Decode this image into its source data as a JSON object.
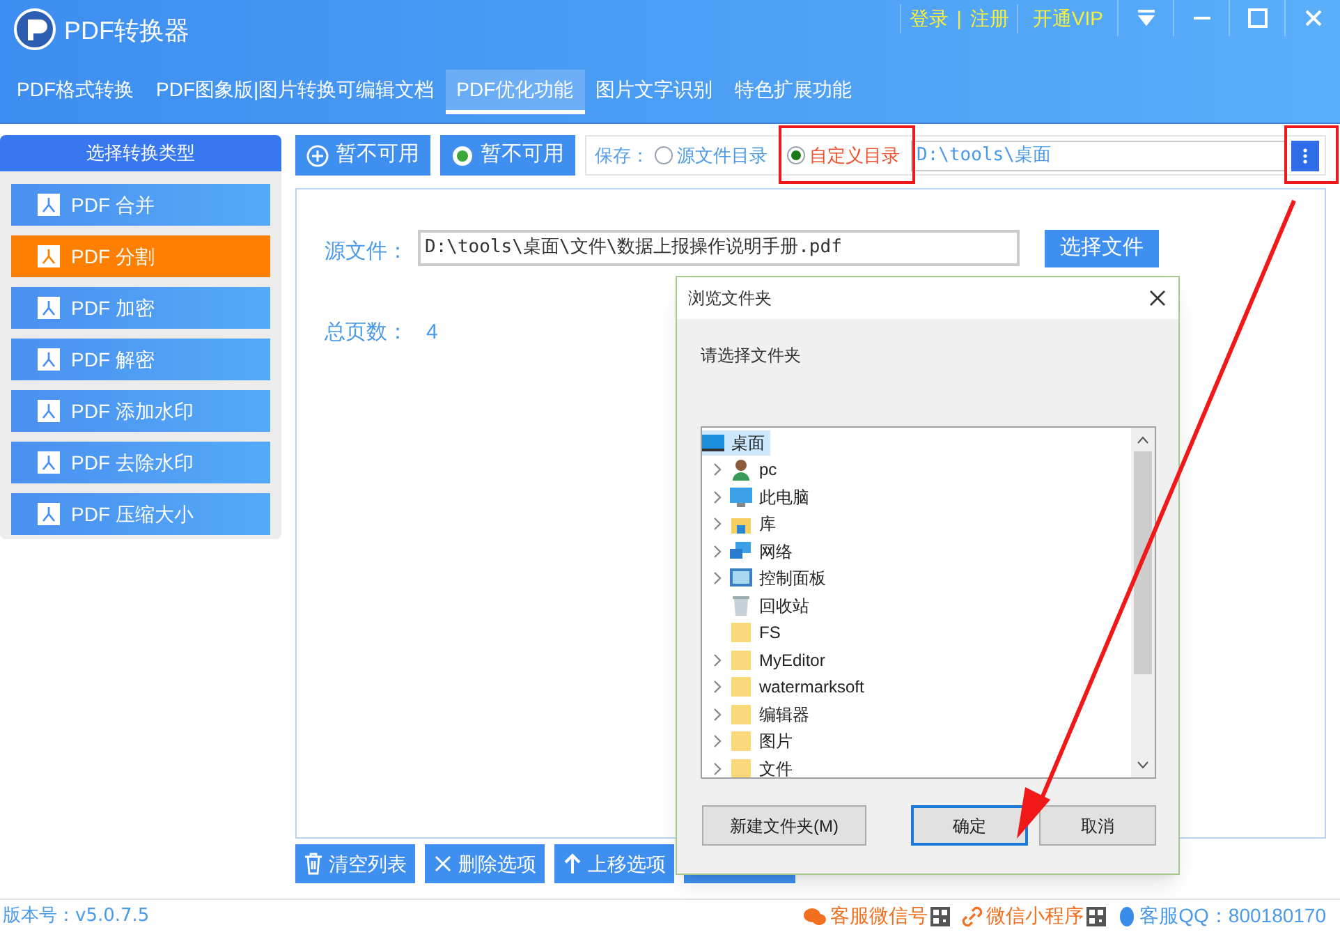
{
  "window": {
    "title": "PDF转换器",
    "links": [
      "登录",
      "|",
      "注册",
      "开通VIP"
    ]
  },
  "tabs": [
    {
      "label": "PDF格式转换",
      "selected": false
    },
    {
      "label": "PDF图象版|图片转换可编辑文档",
      "selected": false
    },
    {
      "label": "PDF优化功能",
      "selected": true
    },
    {
      "label": "图片文字识别",
      "selected": false
    },
    {
      "label": "特色扩展功能",
      "selected": false
    }
  ],
  "sidebar": {
    "title": "选择转换类型",
    "items": [
      {
        "label": "PDF 合并",
        "selected": false
      },
      {
        "label": "PDF 分割",
        "selected": true
      },
      {
        "label": "PDF 加密",
        "selected": false
      },
      {
        "label": "PDF 解密",
        "selected": false
      },
      {
        "label": "PDF 添加水印",
        "selected": false
      },
      {
        "label": "PDF 去除水印",
        "selected": false
      },
      {
        "label": "PDF 压缩大小",
        "selected": false
      }
    ]
  },
  "toolbar": {
    "buttons": [
      {
        "kind": "plus",
        "label": "暂不可用"
      },
      {
        "kind": "dot",
        "label": "暂不可用"
      }
    ],
    "save_label": "保存：",
    "options": [
      {
        "label": "源文件目录",
        "checked": false
      },
      {
        "label": "自定义目录",
        "checked": true
      }
    ],
    "path": "D:\\tools\\桌面"
  },
  "form": {
    "source_label": "源文件：",
    "source_value": "D:\\tools\\桌面\\文件\\数据上报操作说明手册.pdf",
    "choose_button": "选择文件",
    "pages_label": "总页数：",
    "pages_value": "4"
  },
  "bottom_buttons": [
    {
      "kind": "trash",
      "label": "清空列表"
    },
    {
      "kind": "x",
      "label": "删除选项"
    },
    {
      "kind": "up",
      "label": "上移选项"
    }
  ],
  "dialog": {
    "title": "浏览文件夹",
    "prompt": "请选择文件夹",
    "tree": [
      {
        "label": "桌面",
        "kind": "desktop",
        "selected": true,
        "children": [
          {
            "label": "pc",
            "kind": "user",
            "expandable": true,
            "selected": false
          },
          {
            "label": "此电脑",
            "kind": "computer",
            "expandable": true,
            "selected": false
          },
          {
            "label": "库",
            "kind": "library",
            "expandable": true,
            "selected": false
          },
          {
            "label": "网络",
            "kind": "network",
            "expandable": true,
            "selected": false
          },
          {
            "label": "控制面板",
            "kind": "panel",
            "expandable": true,
            "selected": false
          },
          {
            "label": "回收站",
            "kind": "recycle",
            "expandable": false,
            "selected": false
          },
          {
            "label": "FS",
            "kind": "folder",
            "expandable": false,
            "selected": false
          },
          {
            "label": "MyEditor",
            "kind": "folder",
            "expandable": true,
            "selected": false
          },
          {
            "label": "watermarksoft",
            "kind": "folder",
            "expandable": true,
            "selected": false
          },
          {
            "label": "编辑器",
            "kind": "folder",
            "expandable": true,
            "selected": false
          },
          {
            "label": "图片",
            "kind": "folder",
            "expandable": true,
            "selected": false
          },
          {
            "label": "文件",
            "kind": "folder",
            "expandable": true,
            "selected": false
          }
        ]
      }
    ],
    "buttons": [
      {
        "label": "新建文件夹(M)",
        "default": false
      },
      {
        "label": "确定",
        "default": true
      },
      {
        "label": "取消",
        "default": false
      }
    ]
  },
  "status_bar": {
    "version": "版本号：v5.0.7.5",
    "links": [
      {
        "kind": "wechat",
        "label": "客服微信号"
      },
      {
        "kind": "link",
        "label": "微信小程序"
      },
      {
        "kind": "qq",
        "label": "客服QQ：800180170"
      }
    ]
  }
}
